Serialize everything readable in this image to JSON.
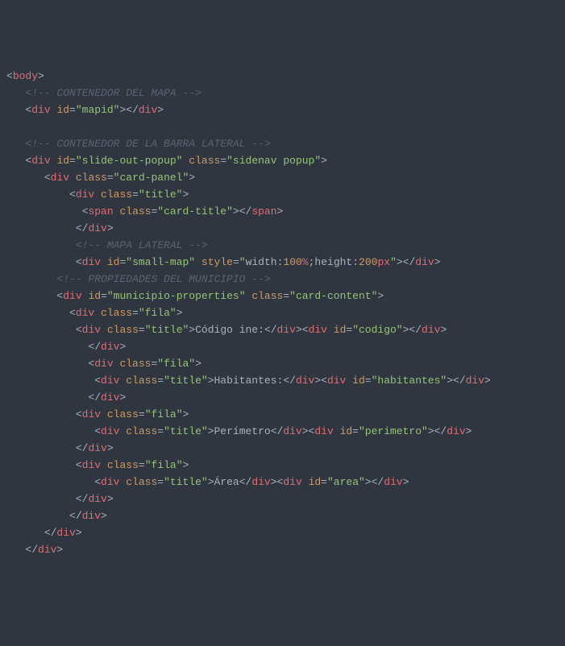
{
  "lines": {
    "l1_body": "body",
    "l2_comment": "<!-- CONTENEDOR DEL MAPA -->",
    "l3_div": "div",
    "l3_id": "id",
    "l3_mapid": "\"mapid\"",
    "l5_comment": "<!-- CONTENEDOR DE LA BARRA LATERAL -->",
    "l6_div": "div",
    "l6_id": "id",
    "l6_idv": "\"slide-out-popup\"",
    "l6_class": "class",
    "l6_classv": "\"sidenav popup\"",
    "l7_div": "div",
    "l7_class": "class",
    "l7_classv": "\"card-panel\"",
    "l8_div": "div",
    "l8_class": "class",
    "l8_classv": "\"title\"",
    "l9_span": "span",
    "l9_class": "class",
    "l9_classv": "\"card-title\"",
    "l11_comment": "<!-- MAPA LATERAL -->",
    "l12_div": "div",
    "l12_id": "id",
    "l12_idv": "\"small-map\"",
    "l12_style": "style",
    "l12_style_open": "\"",
    "l12_width_k": "width",
    "l12_width_v": "100",
    "l12_width_u": "%",
    "l12_height_k": "height",
    "l12_height_v": "200",
    "l12_height_u": "px",
    "l12_style_close": "\"",
    "l13_comment": "<!-- PROPIEDADES DEL MUNICIPIO -->",
    "l14_div": "div",
    "l14_id": "id",
    "l14_idv": "\"municipio-properties\"",
    "l14_class": "class",
    "l14_classv": "\"card-content\"",
    "l15_div": "div",
    "l15_class": "class",
    "l15_classv": "\"fila\"",
    "l16_div": "div",
    "l16_class": "class",
    "l16_classv": "\"title\"",
    "l16_txt": "Código ine:",
    "l16_id": "id",
    "l16_idv": "\"codigo\"",
    "l18_div": "div",
    "l18_class": "class",
    "l18_classv": "\"fila\"",
    "l19_div": "div",
    "l19_class": "class",
    "l19_classv": "\"title\"",
    "l19_txt": "Habitantes:",
    "l19_id": "id",
    "l19_idv": "\"habitantes\"",
    "l21_div": "div",
    "l21_class": "class",
    "l21_classv": "\"fila\"",
    "l22_div": "div",
    "l22_class": "class",
    "l22_classv": "\"title\"",
    "l22_txt": "Perímetro",
    "l22_id": "id",
    "l22_idv": "\"perimetro\"",
    "l24_div": "div",
    "l24_class": "class",
    "l24_classv": "\"fila\"",
    "l25_div": "div",
    "l25_class": "class",
    "l25_classv": "\"title\"",
    "l25_txt": "Área",
    "l25_id": "id",
    "l25_idv": "\"area\""
  }
}
